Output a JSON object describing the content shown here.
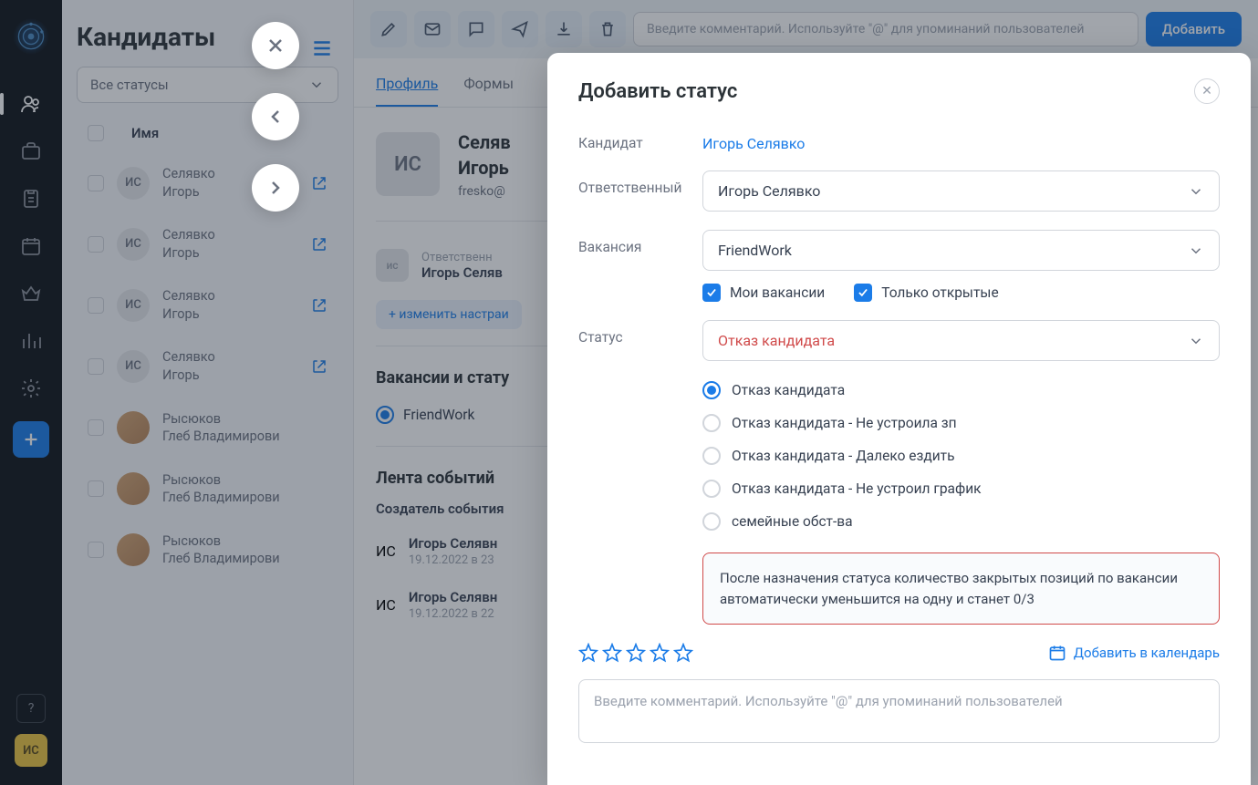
{
  "sidebar": {
    "avatar_initials": "ИС",
    "help_label": "?"
  },
  "list": {
    "title": "Кандидаты",
    "status_filter": "Все статусы",
    "col_name": "Имя",
    "rows": [
      {
        "initials": "ИС",
        "name": "Селявко Игорь",
        "has_open": true
      },
      {
        "initials": "ИС",
        "name": "Селявко Игорь",
        "has_open": true
      },
      {
        "initials": "ИС",
        "name": "Селявко Игорь",
        "has_open": true
      },
      {
        "initials": "ИС",
        "name": "Селявко Игорь",
        "has_open": true
      },
      {
        "initials": "",
        "name": "Рысюков Глеб Владимирови",
        "photo": true
      },
      {
        "initials": "",
        "name": "Рысюков Глеб Владимирови",
        "photo": true
      },
      {
        "initials": "",
        "name": "Рысюков Глеб Владимирови",
        "photo": true
      }
    ]
  },
  "detail": {
    "comment_placeholder": "Введите комментарий. Используйте \"@\" для упоминаний пользователей",
    "add_btn": "Добавить",
    "tabs": {
      "profile": "Профиль",
      "forms": "Формы"
    },
    "avatar_initials": "ИС",
    "name_line1": "Селяв",
    "name_line2": "Игорь",
    "email": "fresko@",
    "responsible_label": "Ответственн",
    "responsible_value": "Игорь Селяв",
    "responsible_initials": "ис",
    "change_link": "+ изменить настраи",
    "vacancy_section": "Вакансии и стату",
    "vacancy_value": "FriendWork",
    "feed_title": "Лента событий",
    "creator_label": "Создатель события",
    "events": [
      {
        "initials": "ИС",
        "name": "Игорь Селявн",
        "time": "19.12.2022 в 23"
      },
      {
        "initials": "ИС",
        "name": "Игорь Селявн",
        "time": "19.12.2022 в 22"
      }
    ]
  },
  "modal": {
    "title": "Добавить статус",
    "candidate_label": "Кандидат",
    "candidate_value": "Игорь Селявко",
    "responsible_label": "Ответственный",
    "responsible_value": "Игорь Селявко",
    "vacancy_label": "Вакансия",
    "vacancy_value": "FriendWork",
    "my_vacancies": "Мои вакансии",
    "open_only": "Только открытые",
    "status_label": "Статус",
    "status_value": "Отказ кандидата",
    "status_options": [
      "Отказ кандидата",
      "Отказ кандидата - Не устроила зп",
      "Отказ кандидата - Далеко ездить",
      "Отказ кандидата - Не устроил график",
      "семейные обст-ва"
    ],
    "alert_text": "После назначения статуса количество закрытых позиций по вакансии автоматически уменьшится на одну и станет 0/3",
    "calendar_link": "Добавить в календарь",
    "comment_placeholder": "Введите комментарий. Используйте \"@\" для упоминаний пользователей"
  }
}
